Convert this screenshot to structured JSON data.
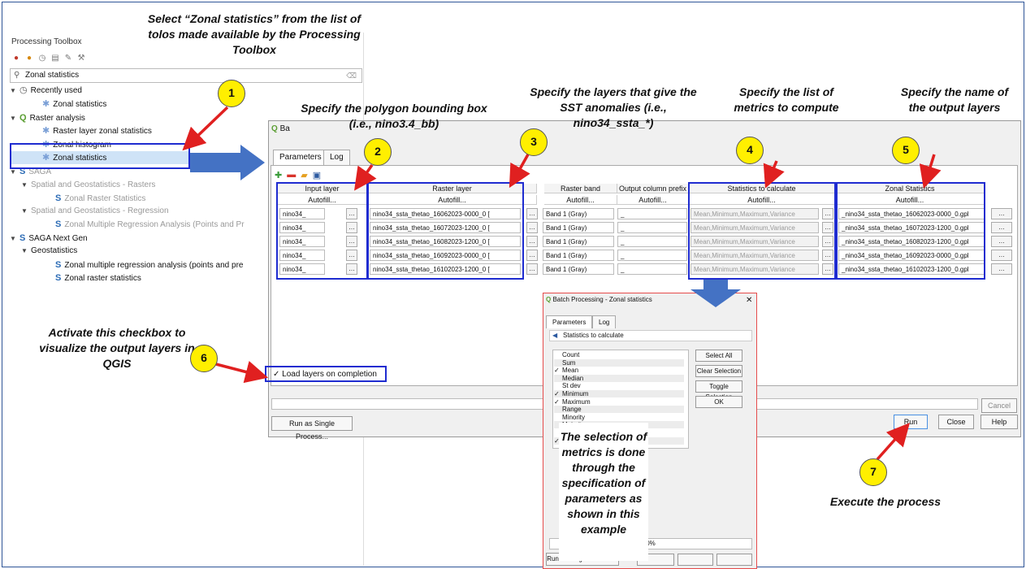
{
  "toolbox": {
    "title": "Processing Toolbox",
    "search_value": "Zonal statistics",
    "tree": [
      {
        "label": "Recently used"
      },
      {
        "label": "Zonal statistics"
      },
      {
        "label": "Raster analysis"
      },
      {
        "label": "Raster layer zonal statistics"
      },
      {
        "label": "Zonal histogram"
      },
      {
        "label": "Zonal statistics"
      },
      {
        "label": "SAGA"
      },
      {
        "label": "Spatial and Geostatistics - Rasters"
      },
      {
        "label": "Zonal Raster Statistics"
      },
      {
        "label": "Spatial and Geostatistics - Regression"
      },
      {
        "label": "Zonal Multiple Regression Analysis (Points and Pr"
      },
      {
        "label": "SAGA Next Gen"
      },
      {
        "label": "Geostatistics"
      },
      {
        "label": "Zonal multiple regression analysis (points and pre"
      },
      {
        "label": "Zonal raster statistics"
      }
    ]
  },
  "batch": {
    "title": "Ba",
    "tabs": [
      "Parameters",
      "Log"
    ],
    "columns": [
      "Input layer",
      "Raster layer",
      "Raster band",
      "Output column prefix",
      "Statistics to calculate",
      "Zonal Statistics"
    ],
    "autofill": "Autofill...",
    "rows": [
      {
        "input": "nino34_",
        "raster": "nino34_ssta_thetao_16062023-0000_0 [",
        "band": "Band 1 (Gray)",
        "prefix": "_",
        "stats": "Mean,Minimum,Maximum,Variance",
        "out": "_nino34_ssta_thetao_16062023-0000_0.gpl"
      },
      {
        "input": "nino34_",
        "raster": "nino34_ssta_thetao_16072023-1200_0 [",
        "band": "Band 1 (Gray)",
        "prefix": "_",
        "stats": "Mean,Minimum,Maximum,Variance",
        "out": "_nino34_ssta_thetao_16072023-1200_0.gpl"
      },
      {
        "input": "nino34_",
        "raster": "nino34_ssta_thetao_16082023-1200_0 [",
        "band": "Band 1 (Gray)",
        "prefix": "_",
        "stats": "Mean,Minimum,Maximum,Variance",
        "out": "_nino34_ssta_thetao_16082023-1200_0.gpl"
      },
      {
        "input": "nino34_",
        "raster": "nino34_ssta_thetao_16092023-0000_0 [",
        "band": "Band 1 (Gray)",
        "prefix": "_",
        "stats": "Mean,Minimum,Maximum,Variance",
        "out": "_nino34_ssta_thetao_16092023-0000_0.gpl"
      },
      {
        "input": "nino34_",
        "raster": "nino34_ssta_thetao_16102023-1200_0 [",
        "band": "Band 1 (Gray)",
        "prefix": "_",
        "stats": "Mean,Minimum,Maximum,Variance",
        "out": "_nino34_ssta_thetao_16102023-1200_0.gpl"
      }
    ],
    "load_layers": "Load layers on completion",
    "cancel": "Cancel",
    "run_single": "Run as Single Process...",
    "run": "Run",
    "close": "Close",
    "help": "Help"
  },
  "batch2": {
    "title": "Batch Processing - Zonal statistics",
    "tabs": [
      "Parameters",
      "Log"
    ],
    "section": "Statistics to calculate",
    "items": [
      {
        "label": "Count",
        "checked": false
      },
      {
        "label": "Sum",
        "checked": false
      },
      {
        "label": "Mean",
        "checked": true
      },
      {
        "label": "Median",
        "checked": false
      },
      {
        "label": "St dev",
        "checked": false
      },
      {
        "label": "Minimum",
        "checked": true
      },
      {
        "label": "Maximum",
        "checked": true
      },
      {
        "label": "Range",
        "checked": false
      },
      {
        "label": "Minority",
        "checked": false
      },
      {
        "label": "Majority",
        "checked": false
      },
      {
        "label": "Variety",
        "checked": false
      },
      {
        "label": "Variance",
        "checked": true
      }
    ],
    "select_all": "Select All",
    "clear_selection": "Clear Selection",
    "toggle_selection": "Toggle Selection",
    "ok": "OK",
    "progress": "0%",
    "run_single": "Run as Single Process..."
  },
  "callouts": {
    "c1": "Select “Zonal statistics” from the list of tolos made available by the Processing Toolbox",
    "c2": "Specify the polygon bounding box (i.e., nino3.4_bb)",
    "c3": "Specify the layers that give the SST anomalies (i.e., nino34_ssta_*)",
    "c4": "Specify the list of metrics to compute",
    "c5": "Specify the name of the output layers",
    "c6": "Activate this checkbox to visualize the output layers in QGIS",
    "c7": "Execute the process",
    "c8": "The selection of metrics is done through the specification of parameters as shown in this example"
  },
  "badges": [
    "1",
    "2",
    "3",
    "4",
    "5",
    "6",
    "7"
  ],
  "colors": {
    "highlight": "#1f2cd0",
    "arrow_red": "#e02020",
    "arrow_blue": "#4472c4",
    "badge": "#ffef00"
  }
}
